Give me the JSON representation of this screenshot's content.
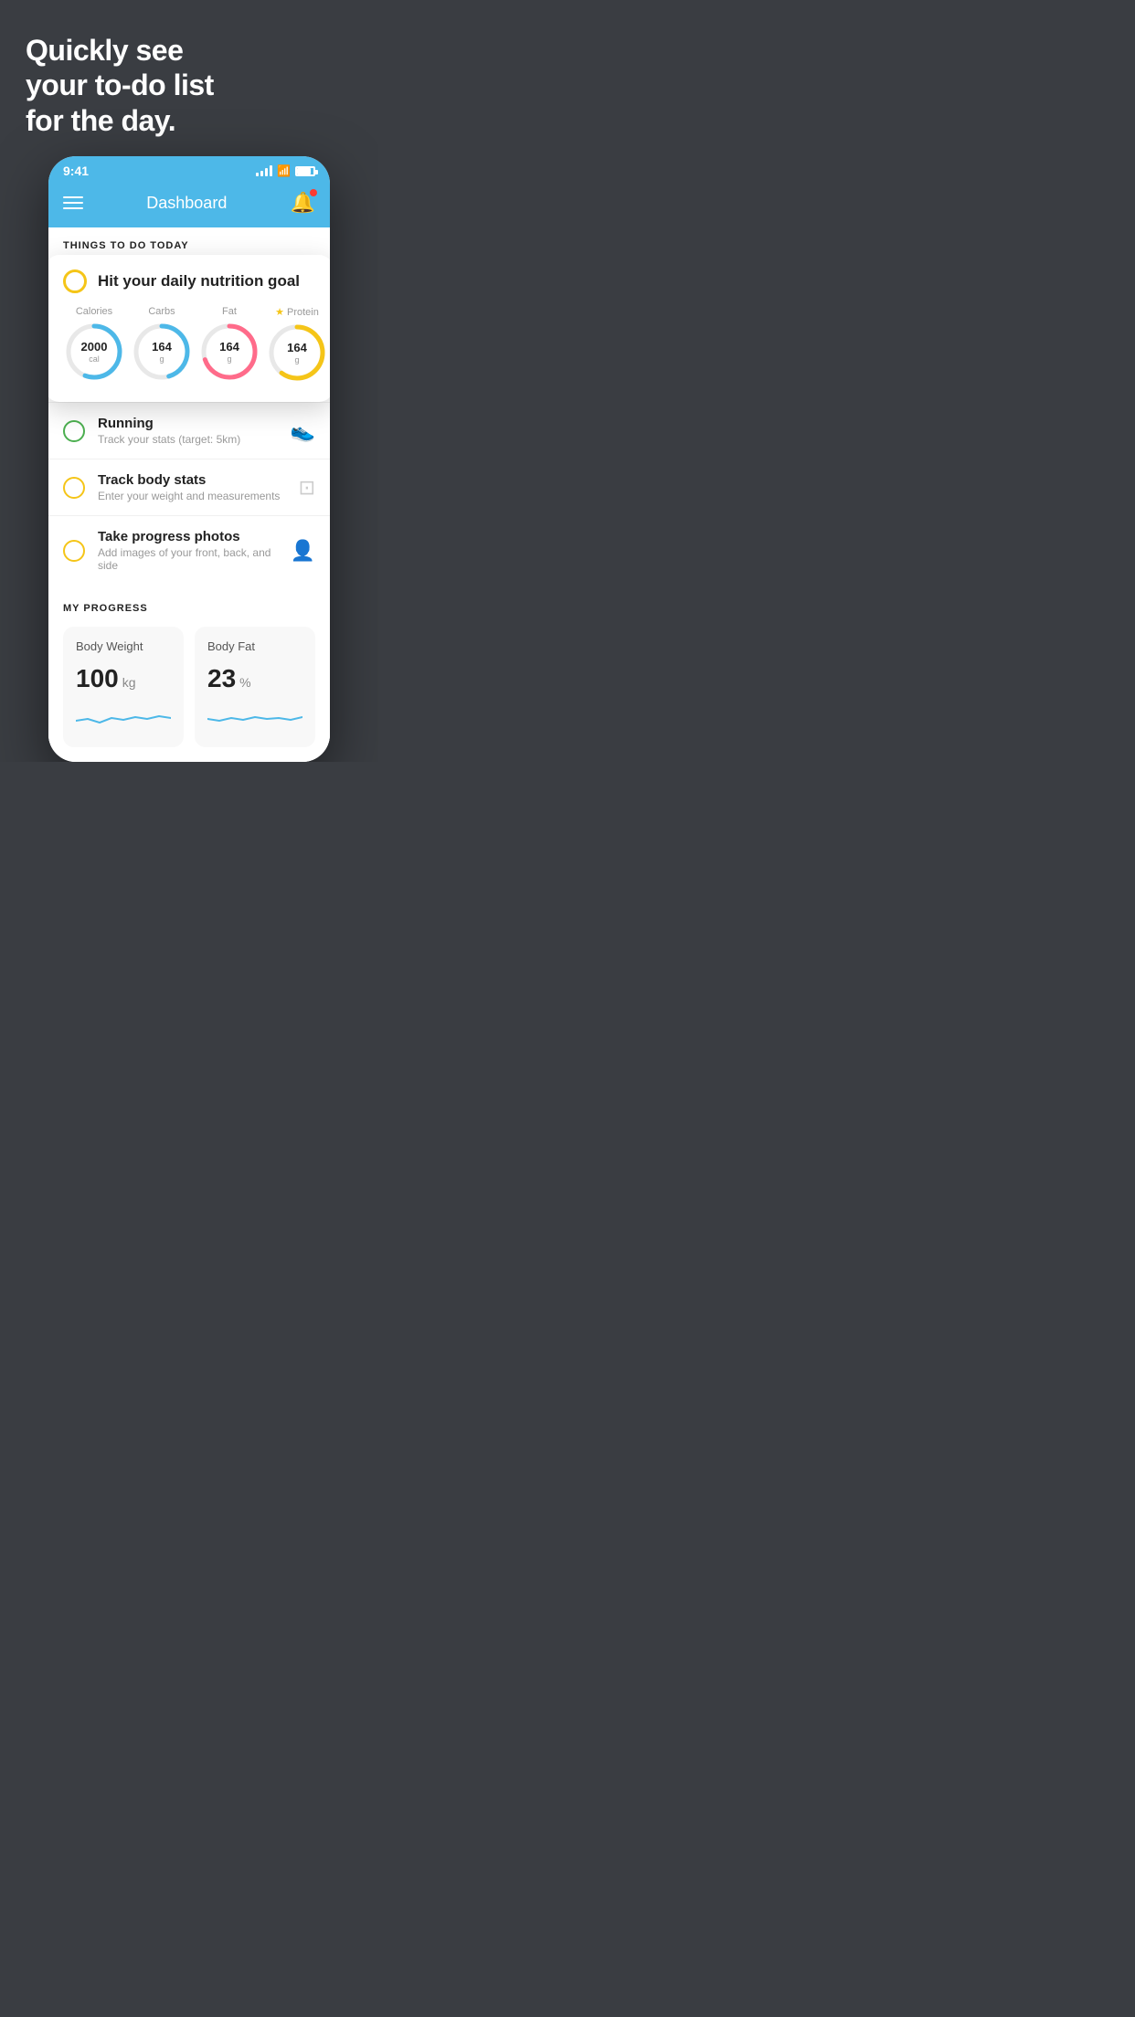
{
  "headline": {
    "line1": "Quickly see",
    "line2": "your to-do list",
    "line3": "for the day."
  },
  "status_bar": {
    "time": "9:41"
  },
  "header": {
    "title": "Dashboard"
  },
  "things_section": {
    "label": "THINGS TO DO TODAY"
  },
  "nutrition_card": {
    "title": "Hit your daily nutrition goal",
    "items": [
      {
        "label": "Calories",
        "value": "2000",
        "unit": "cal",
        "color": "calories",
        "progress": 0.55
      },
      {
        "label": "Carbs",
        "value": "164",
        "unit": "g",
        "color": "carbs",
        "progress": 0.45
      },
      {
        "label": "Fat",
        "value": "164",
        "unit": "g",
        "color": "fat",
        "progress": 0.7
      },
      {
        "label": "Protein",
        "value": "164",
        "unit": "g",
        "color": "protein",
        "progress": 0.6,
        "starred": true
      }
    ]
  },
  "todo_items": [
    {
      "title": "Running",
      "subtitle": "Track your stats (target: 5km)",
      "icon": "shoe",
      "status": "green"
    },
    {
      "title": "Track body stats",
      "subtitle": "Enter your weight and measurements",
      "icon": "scale",
      "status": "yellow"
    },
    {
      "title": "Take progress photos",
      "subtitle": "Add images of your front, back, and side",
      "icon": "person",
      "status": "yellow"
    }
  ],
  "progress_section": {
    "label": "MY PROGRESS",
    "cards": [
      {
        "title": "Body Weight",
        "value": "100",
        "unit": "kg"
      },
      {
        "title": "Body Fat",
        "value": "23",
        "unit": "%"
      }
    ]
  }
}
